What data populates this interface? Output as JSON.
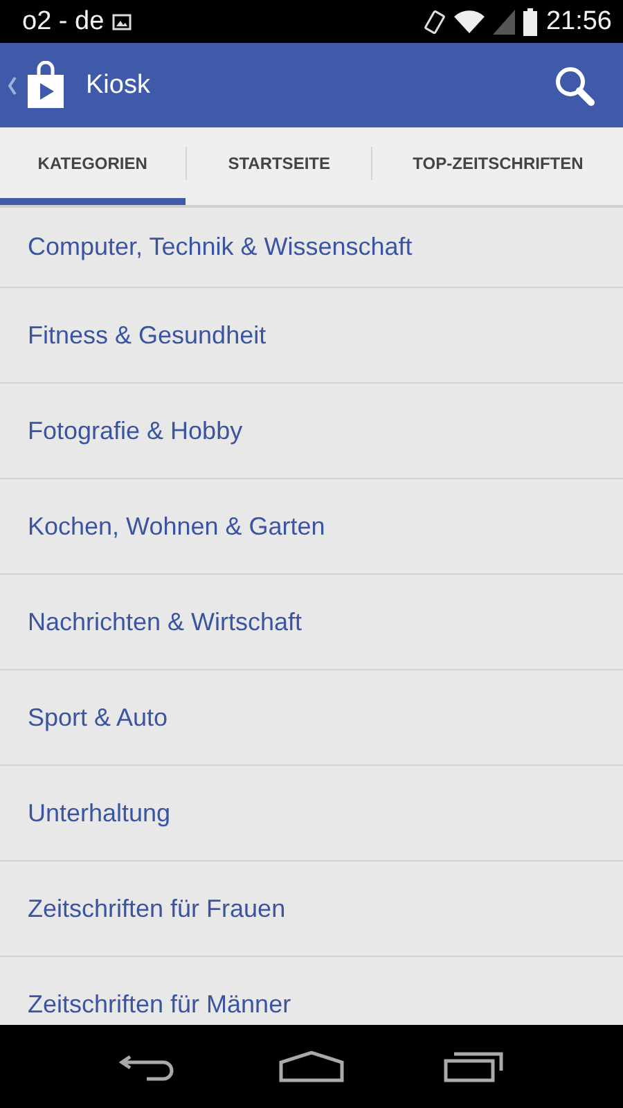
{
  "status_bar": {
    "carrier": "o2 - de",
    "time": "21:56"
  },
  "app_bar": {
    "title": "Kiosk"
  },
  "tabs": [
    {
      "label": "KATEGORIEN",
      "selected": true
    },
    {
      "label": "STARTSEITE",
      "selected": false
    },
    {
      "label": "TOP-ZEITSCHRIFTEN",
      "selected": false
    }
  ],
  "categories": [
    "Computer, Technik & Wissenschaft",
    "Fitness & Gesundheit",
    "Fotografie & Hobby",
    "Kochen, Wohnen & Garten",
    "Nachrichten & Wirtschaft",
    "Sport & Auto",
    "Unterhaltung",
    "Zeitschriften für Frauen",
    "Zeitschriften für Männer"
  ]
}
